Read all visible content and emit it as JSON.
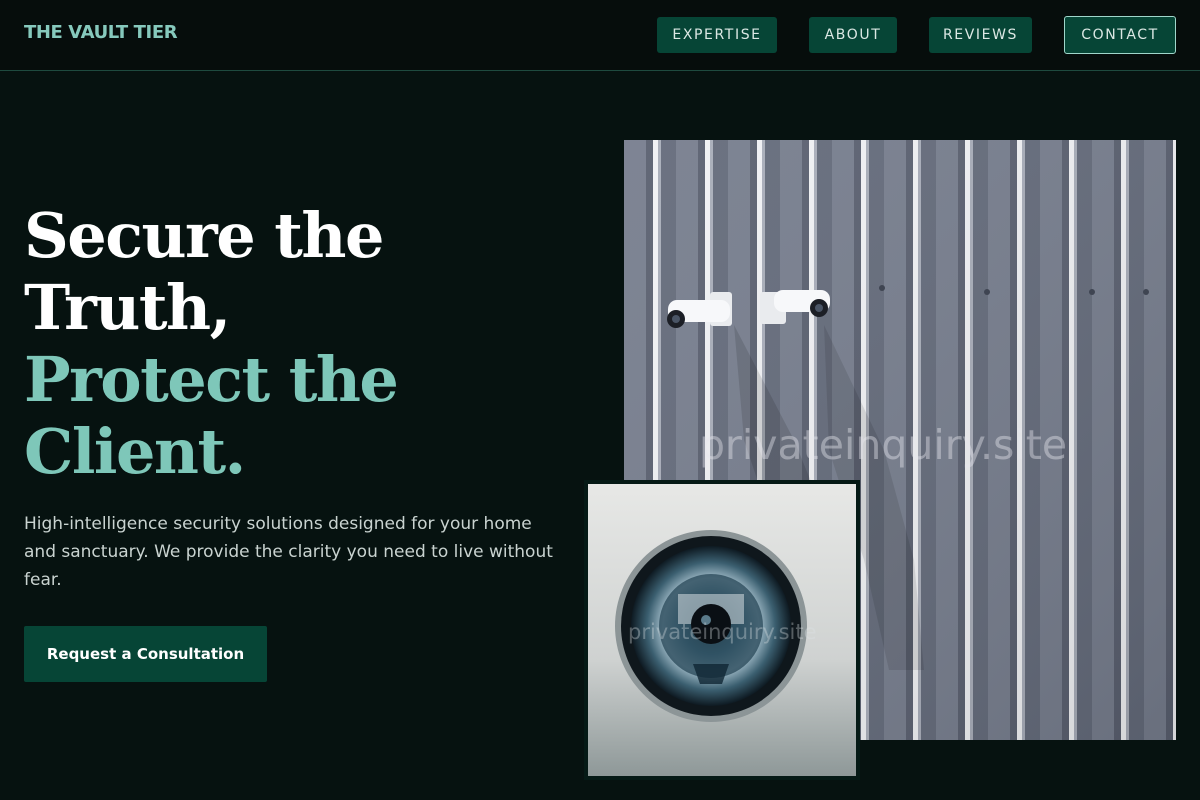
{
  "brand": {
    "name": "THE VAULT TIER"
  },
  "nav": {
    "expertise": "EXPERTISE",
    "about": "ABOUT",
    "reviews": "REVIEWS",
    "contact": "CONTACT"
  },
  "hero": {
    "line1": "Secure the",
    "line2": "Truth,",
    "line3": "Protect the",
    "line4": "Client.",
    "description": "High-intelligence security solutions designed for your home and sanctuary. We provide the clarity you need to live without fear.",
    "cta_label": "Request a Consultation"
  },
  "images": {
    "main_watermark": "privateinquiry.site",
    "inset_watermark": "privateinquiry.site"
  },
  "colors": {
    "background": "#061210",
    "accent": "#7ec7b9",
    "button": "#064536"
  }
}
